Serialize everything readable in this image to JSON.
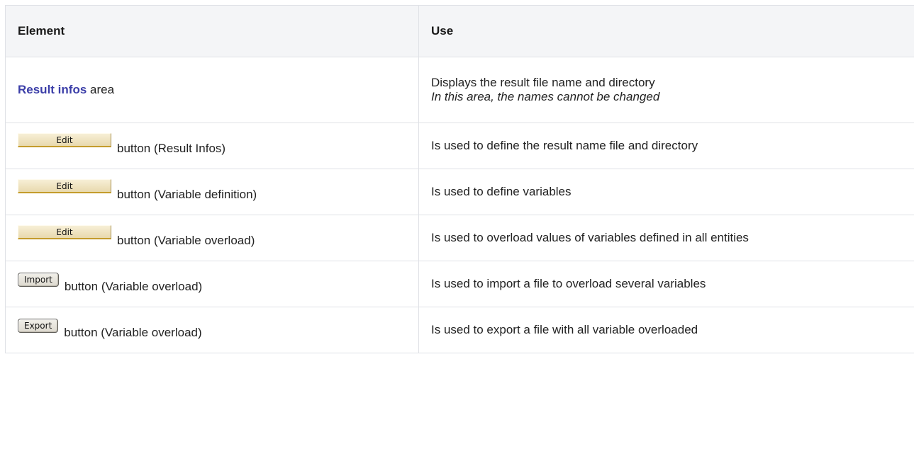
{
  "table": {
    "headers": {
      "element": "Element",
      "use": "Use"
    },
    "rows": [
      {
        "element_link": "Result infos",
        "element_suffix": " area",
        "use_text": "Displays the result file name and directory",
        "use_note": "In this area, the names cannot be changed"
      },
      {
        "button_label": "Edit",
        "element_suffix": "button (Result Infos)",
        "use_text": "Is used to define the result name file and directory"
      },
      {
        "button_label": "Edit",
        "element_suffix": "button (Variable definition)",
        "use_text": "Is used to define variables"
      },
      {
        "button_label": "Edit",
        "element_suffix": "button (Variable overload)",
        "use_text": "Is used to overload values of variables defined in all entities"
      },
      {
        "button_label": "Import",
        "element_suffix": "button (Variable overload)",
        "use_text": "Is used to import a file to overload several variables"
      },
      {
        "button_label": "Export",
        "element_suffix": "button (Variable overload)",
        "use_text": "Is used to export a file with all variable overloaded"
      }
    ]
  }
}
